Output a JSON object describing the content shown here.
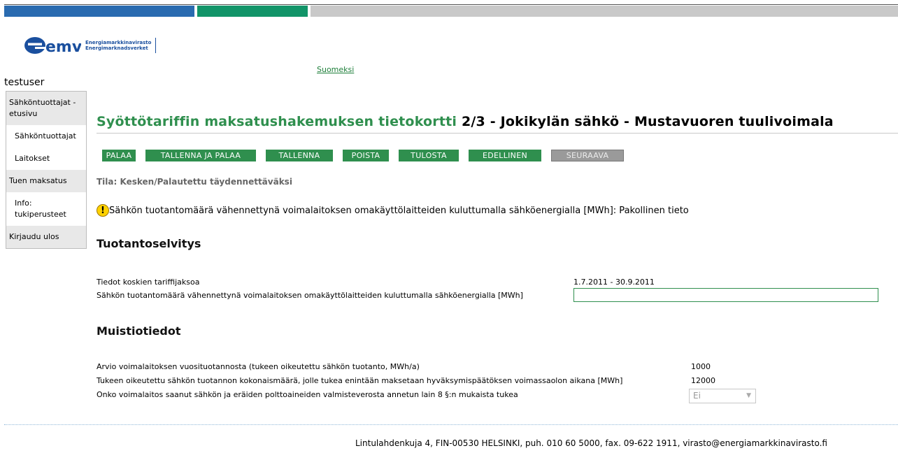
{
  "brand": {
    "logo_letters": "emv",
    "name_fi": "Energiamarkkinavirasto",
    "name_sv": "Energimarknadsverket"
  },
  "language_link": "Suomeksi",
  "user": "testuser",
  "sidebar": {
    "items": [
      {
        "label": "Sähköntuottajat - etusivu"
      },
      {
        "label": "Sähköntuottajat"
      },
      {
        "label": "Laitokset"
      },
      {
        "label": "Tuen maksatus"
      },
      {
        "label": "Info: tukiperusteet"
      },
      {
        "label": "Kirjaudu ulos"
      }
    ]
  },
  "page": {
    "title_green": "Syöttötariffin maksatushakemuksen tietokortti",
    "title_black": " 2/3 - Jokikylän sähkö - Mustavuoren tuulivoimala"
  },
  "buttons": {
    "back": "PALAA",
    "save_and_back": "TALLENNA JA PALAA",
    "save": "TALLENNA",
    "delete": "POISTA",
    "print": "TULOSTA",
    "previous": "EDELLINEN",
    "next": "SEURAAVA"
  },
  "status": "Tila: Kesken/Palautettu täydennettäväksi",
  "warning": {
    "icon": "!",
    "text": "Sähkön tuotantomäärä vähennettynä voimalaitoksen omakäyttölaitteiden kuluttumalla sähköenergialla [MWh]: Pakollinen tieto"
  },
  "production": {
    "heading": "Tuotantoselvitys",
    "period_label": "Tiedot koskien tariffijaksoa",
    "period_value": "1.7.2011 - 30.9.2011",
    "amount_label": "Sähkön tuotantomäärä vähennettynä voimalaitoksen omakäyttölaitteiden kuluttumalla sähköenergialla [MWh]",
    "amount_value": ""
  },
  "memo": {
    "heading": "Muistiotiedot",
    "rows": [
      {
        "label": "Arvio voimalaitoksen vuosituotannosta (tukeen oikeutettu sähkön tuotanto, MWh/a)",
        "value": "1000"
      },
      {
        "label": "Tukeen oikeutettu sähkön tuotannon kokonaismäärä, jolle tukea enintään maksetaan hyväksymispäätöksen voimassaolon aikana [MWh]",
        "value": "12000"
      },
      {
        "label": "Onko voimalaitos saanut sähkön ja eräiden polttoaineiden valmisteverosta annetun lain 8 §:n mukaista tukea",
        "value": "Ei"
      }
    ]
  },
  "footer": "Lintulahdenkuja 4, FIN-00530 HELSINKI, puh. 010 60 5000, fax. 09-622 1911, virasto@energiamarkkinavirasto.fi",
  "colors": {
    "primary_green": "#2f8f4e",
    "brand_blue": "#1a4f9e",
    "bar_blue": "#2a6bb0",
    "bar_green": "#129468",
    "bar_gray": "#c9c9c9"
  }
}
